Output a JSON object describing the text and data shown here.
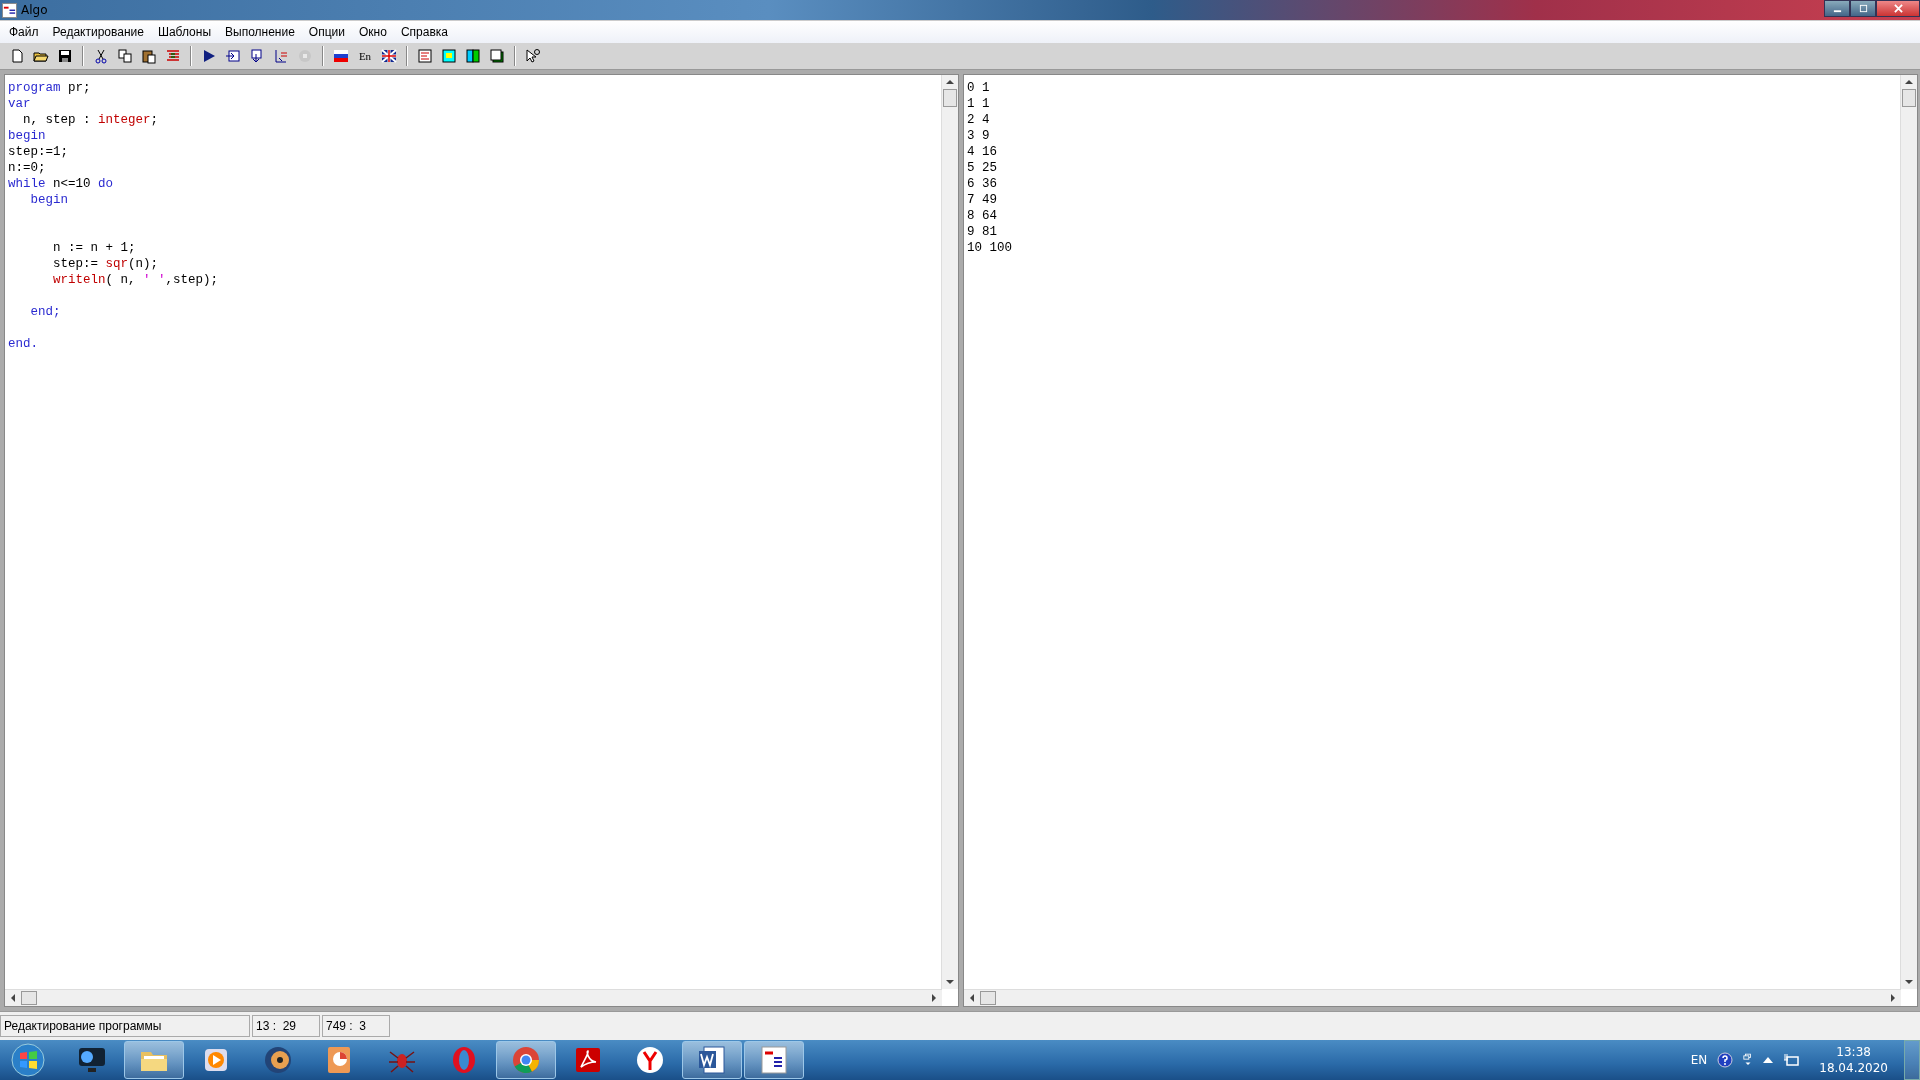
{
  "window": {
    "title": "Algo"
  },
  "menu": [
    "Файл",
    "Редактирование",
    "Шаблоны",
    "Выполнение",
    "Опции",
    "Окно",
    "Справка"
  ],
  "toolbar": [
    {
      "kind": "new",
      "disabled": false
    },
    {
      "kind": "open",
      "disabled": false
    },
    {
      "kind": "save",
      "disabled": false
    },
    {
      "kind": "sep"
    },
    {
      "kind": "cut",
      "disabled": false
    },
    {
      "kind": "copy",
      "disabled": false
    },
    {
      "kind": "paste",
      "disabled": false
    },
    {
      "kind": "format",
      "disabled": false
    },
    {
      "kind": "sep"
    },
    {
      "kind": "run",
      "disabled": false
    },
    {
      "kind": "step",
      "disabled": false
    },
    {
      "kind": "step-into",
      "disabled": false
    },
    {
      "kind": "step-out",
      "disabled": false
    },
    {
      "kind": "stop",
      "disabled": true
    },
    {
      "kind": "sep"
    },
    {
      "kind": "flag-ru",
      "disabled": false
    },
    {
      "kind": "text",
      "label": "En",
      "disabled": false
    },
    {
      "kind": "flag-uk",
      "disabled": false
    },
    {
      "kind": "sep"
    },
    {
      "kind": "view-code",
      "disabled": false
    },
    {
      "kind": "view-vars",
      "disabled": false
    },
    {
      "kind": "view-split",
      "disabled": false
    },
    {
      "kind": "view-windows",
      "disabled": false
    },
    {
      "kind": "sep"
    },
    {
      "kind": "help-pointer",
      "disabled": false
    }
  ],
  "editor": {
    "lines": [
      [
        {
          "t": "program",
          "kind": "keyword"
        },
        {
          "t": " pr;",
          "kind": "plain"
        }
      ],
      [
        {
          "t": "var",
          "kind": "keyword"
        }
      ],
      [
        {
          "t": "  n, step : ",
          "kind": "plain"
        },
        {
          "t": "integer",
          "kind": "builtin"
        },
        {
          "t": ";",
          "kind": "plain"
        }
      ],
      [
        {
          "t": "begin",
          "kind": "keyword"
        }
      ],
      [
        {
          "t": "step:=1;",
          "kind": "plain"
        }
      ],
      [
        {
          "t": "n:=0;",
          "kind": "plain"
        }
      ],
      [
        {
          "t": "while",
          "kind": "keyword"
        },
        {
          "t": " n<=10 ",
          "kind": "plain"
        },
        {
          "t": "do",
          "kind": "keyword"
        }
      ],
      [
        {
          "t": "   begin",
          "kind": "keyword"
        }
      ],
      {
        "kind": "blank"
      },
      {
        "kind": "blank"
      },
      [
        {
          "t": "      n := n + 1;",
          "kind": "plain"
        }
      ],
      [
        {
          "t": "      step:= ",
          "kind": "plain"
        },
        {
          "t": "sqr",
          "kind": "builtin"
        },
        {
          "t": "(n);",
          "kind": "plain"
        }
      ],
      [
        {
          "t": "      writeln",
          "kind": "builtin"
        },
        {
          "t": "( n, ",
          "kind": "plain"
        },
        {
          "t": "' '",
          "kind": "string"
        },
        {
          "t": ",step);",
          "kind": "plain"
        }
      ],
      {
        "kind": "blank"
      },
      [
        {
          "t": "   end;",
          "kind": "keyword"
        }
      ],
      {
        "kind": "blank"
      },
      [
        {
          "t": "end.",
          "kind": "keyword"
        }
      ]
    ]
  },
  "output": {
    "lines": [
      "0 1",
      "1 1",
      "2 4",
      "3 9",
      "4 16",
      "5 25",
      "6 36",
      "7 49",
      "8 64",
      "9 81",
      "10 100"
    ]
  },
  "status_bar": {
    "message": "Редактирование программы",
    "cursor": "13 :  29",
    "size": "749 :  3"
  },
  "taskbar": {
    "apps": [
      {
        "kind": "media-monitor",
        "running": false
      },
      {
        "kind": "folder",
        "running": true
      },
      {
        "kind": "play",
        "running": false
      },
      {
        "kind": "disc-player",
        "running": false
      },
      {
        "kind": "presentation",
        "running": false
      },
      {
        "kind": "spider",
        "running": false
      },
      {
        "kind": "opera",
        "running": false
      },
      {
        "kind": "browser",
        "running": true
      },
      {
        "kind": "pdf",
        "running": false
      },
      {
        "kind": "yandex",
        "running": false
      },
      {
        "kind": "word",
        "running": true
      },
      {
        "kind": "algo",
        "running": true
      }
    ],
    "language": "EN",
    "time": "13:38",
    "date": "18.04.2020"
  }
}
